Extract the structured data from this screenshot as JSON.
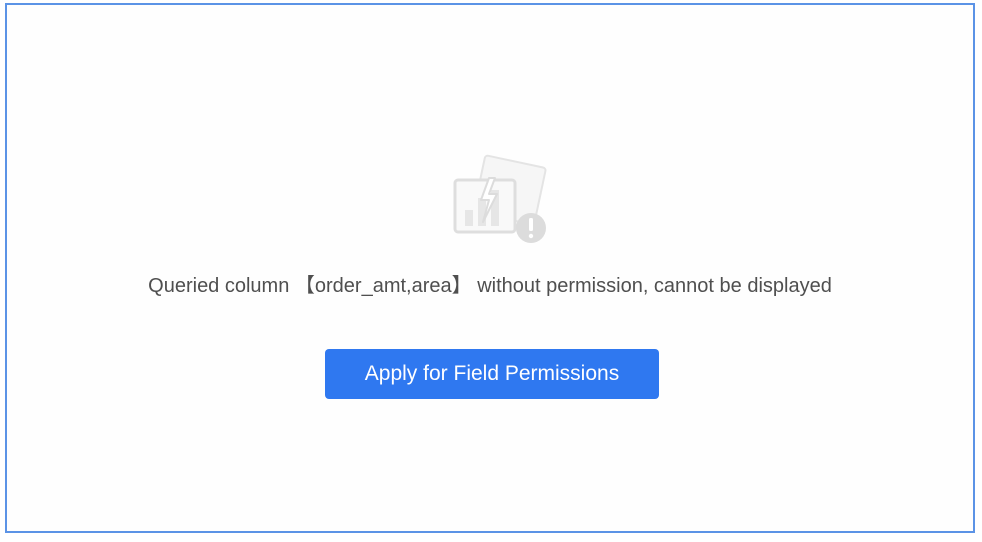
{
  "empty_state": {
    "icon": "permission-denied-chart-icon",
    "message": "Queried column 【order_amt,area】 without permission, cannot be displayed",
    "button_label": "Apply for Field Permissions"
  },
  "colors": {
    "frame_border": "#5b93e6",
    "button_bg": "#2f78f0",
    "button_text": "#ffffff",
    "message_text": "#4f4f4f",
    "icon_gray": "#e3e3e3"
  }
}
